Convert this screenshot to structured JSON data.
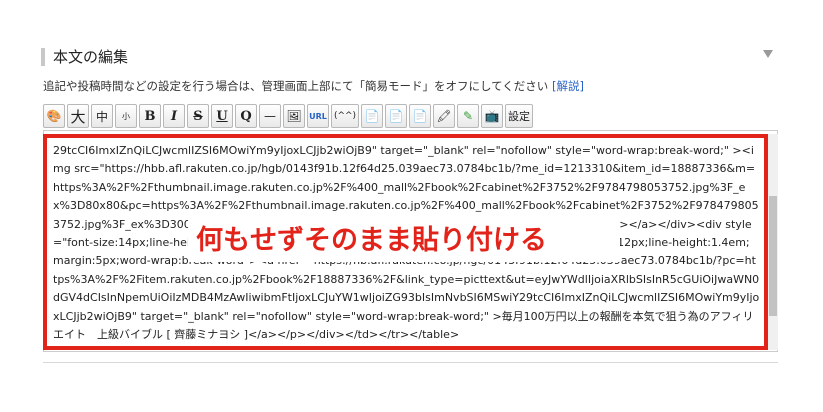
{
  "section": {
    "title": "本文の編集"
  },
  "hint": {
    "text": "追記や投稿時間などの設定を行う場合は、管理画面上部にて「簡易モード」をオフにしてください ",
    "link": "[解説]"
  },
  "toolbar": {
    "buttons": [
      {
        "name": "palette-icon",
        "label": "🎨"
      },
      {
        "name": "font-large-button",
        "label": "大"
      },
      {
        "name": "font-medium-button",
        "label": "中"
      },
      {
        "name": "font-small-button",
        "label": "小"
      },
      {
        "name": "bold-button",
        "label": "B"
      },
      {
        "name": "italic-button",
        "label": "I"
      },
      {
        "name": "strikethrough-button",
        "label": "S"
      },
      {
        "name": "underline-button",
        "label": "U"
      },
      {
        "name": "quote-button",
        "label": "Q"
      },
      {
        "name": "horizontal-rule-button",
        "label": "—"
      },
      {
        "name": "image-icon",
        "label": "🖼"
      },
      {
        "name": "url-button",
        "label": "URL"
      },
      {
        "name": "emoticon-button",
        "label": "(^^)"
      },
      {
        "name": "doc-d-icon",
        "label": "📄"
      },
      {
        "name": "doc-a-icon",
        "label": "📄"
      },
      {
        "name": "doc-plain-icon",
        "label": "📄"
      },
      {
        "name": "marker-icon",
        "label": "🖍"
      },
      {
        "name": "pen-icon",
        "label": "✎"
      },
      {
        "name": "fc2-tv-icon",
        "label": "📺"
      },
      {
        "name": "settings-button",
        "label": "設定"
      }
    ]
  },
  "editor": {
    "content": "29tcCI6ImxIZnQiLCJwcmlIZSI6MOwiYm9yIjoxLCJjb2wiOjB9\" target=\"_blank\" rel=\"nofollow\" style=\"word-wrap:break-word;\" ><img src=\"https://hbb.afl.rakuten.co.jp/hgb/0143f91b.12f64d25.039aec73.0784bc1b/?me_id=1213310&item_id=18887336&m=https%3A%2F%2Fthumbnail.image.rakuten.co.jp%2F%400_mall%2Fbook%2Fcabinet%2F3752%2F9784798053752.jpg%3F_ex%3D80x80&pc=https%3A%2F%2Fthumbnail.image.rakuten.co.jp%2F%400_mall%2Fbook%2Fcabinet%2F3752%2F9784798053752.jpg%3F_ex%3D300x300&s=300x300&t=picttext\" border=\"0\" style=\"margin:2px\" alt=\"\" title=\"\"></a></div><div style=\"font-size:14px;line-height:1.4em;text-align:left;margin:0px;padding:2px 6px;\"><p style=\"font-size:12px;line-height:1.4em;margin:5px;word-wrap:break-word\"><a href=\"https://hb.afl.rakuten.co.jp/hgc/0143f91b.12f64d25.039aec73.0784bc1b/?pc=https%3A%2F%2Fitem.rakuten.co.jp%2Fbook%2F18887336%2F&link_type=picttext&ut=eyJwYWdlIjoiaXRlbSIsInR5cGUiOiJwaWN0dGV4dCIsInNpemUiOiIzMDB4MzAwIiwibmFtIjoxLCJuYW1wIjoiZG93bIsImNvbSI6MSwiY29tcCI6ImxIZnQiLCJwcmlIZSI6MOwiYm9yIjoxLCJjb2wiOjB9\" target=\"_blank\" rel=\"nofollow\" style=\"word-wrap:break-word;\" >毎月100万円以上の報酬を本気で狙う為のアフィリエイト　上級バイブル [ 齊藤ミナヨシ ]</a></p></div></td></tr></table>"
  },
  "overlay": {
    "text": "何もせずそのまま貼り付ける"
  },
  "colors": {
    "accent_red": "#e2231a",
    "link_blue": "#2a63c6"
  }
}
